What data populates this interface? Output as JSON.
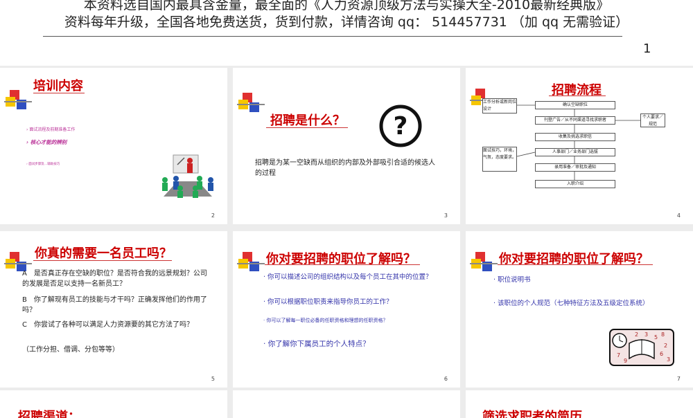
{
  "header": {
    "line1": "本资料选自国内最具含金量，最全面的《人力资源顶级方法与实操大全-2010最新经典版》",
    "line2": "资料每年升级，全国各地免费送货，货到付款，详情咨询 qq： 514457731 （加 qq 无需验证）",
    "page_number": "1"
  },
  "slides": [
    {
      "number": "2",
      "title": "培训内容",
      "items": [
        "面试流程及前期准备工作",
        "核心才能的辨别",
        "面试步骤及…辅助技巧"
      ]
    },
    {
      "number": "3",
      "title": "招聘是什么？",
      "body": "招聘是为某一空缺而从组织的内部及外部吸引合适的候选人的过程"
    },
    {
      "number": "4",
      "title": "招聘流程",
      "flow": [
        "确认空缺职位",
        "刊登广告／从不同渠道寻找求职者",
        "收集及挑选求职信",
        "人事部门／业务部门选拔",
        "录用准备／审批及通知",
        "入职介绍"
      ],
      "notes": {
        "top_left": "工作分析或新岗位设计",
        "right": "个人要求／规范",
        "left": "面试技巧，环境，气氛，态度要求。"
      }
    },
    {
      "number": "5",
      "title": "你真的需要一名员工吗？",
      "paragraphs": [
        "A　是否真正存在空缺的职位？是否符合我的远景规划？公司的发展是否足以支持一名新员工？",
        "B　你了解现有员工的技能与才干吗？正确发挥他们的作用了吗？",
        "C　你尝试了各种可以满足人力资源要的其它方法了吗？",
        "（工作分担、借调、分包等等）"
      ]
    },
    {
      "number": "6",
      "title": "你对要招聘的职位了解吗？",
      "bullets": [
        "你可以描述公司的组织结构以及每个员工在其中的位置？",
        "你可以根据职位职责来指导你员工的工作？",
        "你可以了解每一职位必备的任职资格和理想的任职资格？",
        "你了解你下属员工的个人特点？"
      ]
    },
    {
      "number": "7",
      "title": "你对要招聘的职位了解吗？",
      "bullets": [
        "职位说明书",
        "该职位的个人规范（七种特征方法及五级定位系统）"
      ]
    },
    {
      "title": "招聘渠道："
    },
    {
      "title": ""
    },
    {
      "title": "筛选求职者的简历"
    }
  ]
}
